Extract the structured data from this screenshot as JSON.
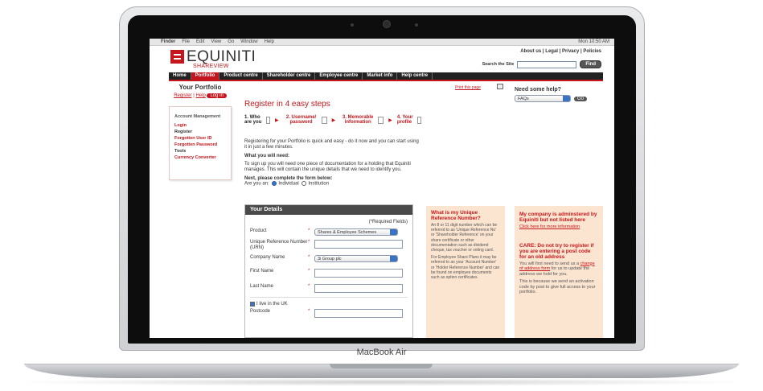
{
  "menubar": {
    "app": "Finder",
    "items": [
      "File",
      "Edit",
      "View",
      "Go",
      "Window",
      "Help"
    ],
    "clock": "Mon 10:50 AM"
  },
  "header": {
    "logo_text": "EQUINITI",
    "logo_sub": "SHAREVIEW",
    "toplinks": "About us | Legal | Privacy | Policies",
    "search_label": "Search the Site",
    "search_button": "Find"
  },
  "nav": {
    "items": [
      "Home",
      "Portfolio",
      "Product centre",
      "Shareholder centre",
      "Employee centre",
      "Market info",
      "Help centre"
    ],
    "active": "Portfolio"
  },
  "sidebar": {
    "title": "Your Portfolio",
    "register": "Register",
    "help": "Help",
    "login_button": "Log in",
    "account_title": "Account Management",
    "links": [
      "Login",
      "Register",
      "Forgotten User ID",
      "Forgotten Password"
    ],
    "tools_title": "Tools",
    "tools_links": [
      "Currency Converter"
    ]
  },
  "main": {
    "print_link": "Print this page",
    "title": "Register in 4 easy steps",
    "steps": [
      "1. Who are you",
      "2. Username/ password",
      "3. Memorable information",
      "4. Your profile"
    ],
    "intro": "Registering for your Portfolio is quick and easy - do it now and you can start using it in just a few minutes.",
    "need_title": "What you will need:",
    "need_text": "To sign up you will need one piece of documentation for a holding that Equiniti manages. This will contain the unique details that we need to identify you.",
    "next": "Next, please complete the form below:",
    "are_you": "Are you an:",
    "opt_individual": "Individual",
    "opt_institution": "Institution"
  },
  "form": {
    "header": "Your Details",
    "required": "(*Required Fields)",
    "product_label": "Product",
    "product_value": "Shares & Employee Schemes",
    "urn_label": "Unique Reference Number (URN)",
    "company_label": "Company Name",
    "company_value": "3i Group plc",
    "first_label": "First Name",
    "last_label": "Last Name",
    "uk_label": "I live in the UK",
    "postcode_label": "Postcode"
  },
  "urn_info": {
    "title": "What is my Unique Reference Number?",
    "p1": "An 8 or 11 digit number which can be referred to as 'Unique Reference No' or 'Shareholder Reference' on your share certificate or other documentation such as dividend cheque, tax voucher or voting card.",
    "p2": "For Employee Share Plans it may be referred to as your 'Account Number' or 'Holder Reference Number' and can be found on employee documents such as option certificates."
  },
  "help": {
    "title": "Need some help?",
    "select_value": "FAQs",
    "go": "Go"
  },
  "company_info": {
    "title": "My company is adminstered by Equiniti but not listed here",
    "link": "Click here for more information",
    "care_title": "CARE: Do not try to register if you are entering a post code for an old address",
    "care_p1_a": "You will first need to send us a",
    "care_link": "change of address form",
    "care_p1_b": "for us to update the address we hold for you.",
    "care_p2": "This is because we send an activation code by post to give full access to your portfolio."
  },
  "laptop": {
    "brand": "MacBook Air"
  }
}
